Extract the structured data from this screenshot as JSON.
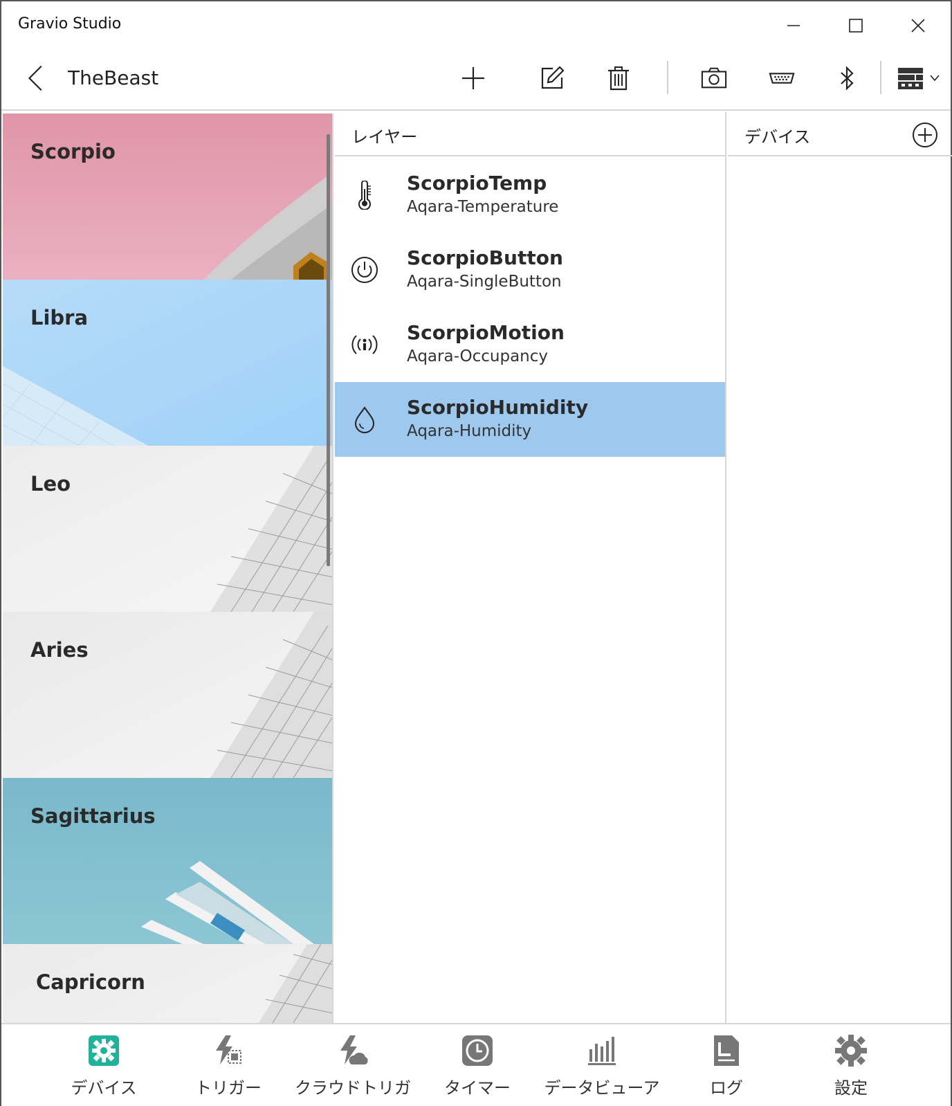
{
  "window": {
    "title": "Gravio Studio"
  },
  "command_bar": {
    "page_title": "TheBeast",
    "buttons": [
      "add-icon",
      "edit-icon",
      "delete-icon",
      "camera-icon",
      "serial-port-icon",
      "bluetooth-icon",
      "view-layout-icon"
    ]
  },
  "areas": [
    {
      "name": "Scorpio",
      "color": "#e498ab"
    },
    {
      "name": "Libra",
      "color": "#a9d5f7"
    },
    {
      "name": "Leo",
      "color": "#f0f0f0"
    },
    {
      "name": "Aries",
      "color": "#eeeeee"
    },
    {
      "name": "Sagittarius",
      "color": "#7fbccd"
    },
    {
      "name": "Capricorn",
      "color": "#efefef"
    }
  ],
  "layers": {
    "header": "レイヤー",
    "items": [
      {
        "name": "ScorpioTemp",
        "type": "Aqara-Temperature",
        "icon": "thermometer-icon"
      },
      {
        "name": "ScorpioButton",
        "type": "Aqara-SingleButton",
        "icon": "power-button-icon"
      },
      {
        "name": "ScorpioMotion",
        "type": "Aqara-Occupancy",
        "icon": "occupancy-icon"
      },
      {
        "name": "ScorpioHumidity",
        "type": "Aqara-Humidity",
        "icon": "droplet-icon",
        "selected": true
      }
    ]
  },
  "devices": {
    "header": "デバイス"
  },
  "bottom_nav": [
    {
      "label": "デバイス",
      "icon": "device-gear-icon",
      "active": true
    },
    {
      "label": "トリガー",
      "icon": "trigger-icon"
    },
    {
      "label": "クラウドトリガー",
      "icon": "cloud-trigger-icon"
    },
    {
      "label": "タイマー",
      "icon": "timer-icon"
    },
    {
      "label": "データビューア",
      "icon": "data-viewer-icon"
    },
    {
      "label": "ログ",
      "icon": "log-icon"
    },
    {
      "label": "設定",
      "icon": "settings-icon"
    }
  ],
  "colors": {
    "accent": "#1fb39a",
    "selected_row": "#9ec9ee"
  }
}
